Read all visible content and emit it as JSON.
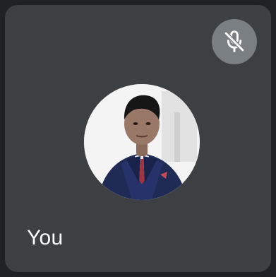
{
  "participant": {
    "name": "You",
    "mic_state_icon": "mic-off-icon",
    "avatar_icon": "profile-photo"
  },
  "colors": {
    "page_bg": "#202124",
    "tile_bg": "#3c4043",
    "mute_badge_bg": "#7a7f84",
    "text": "#ffffff"
  }
}
